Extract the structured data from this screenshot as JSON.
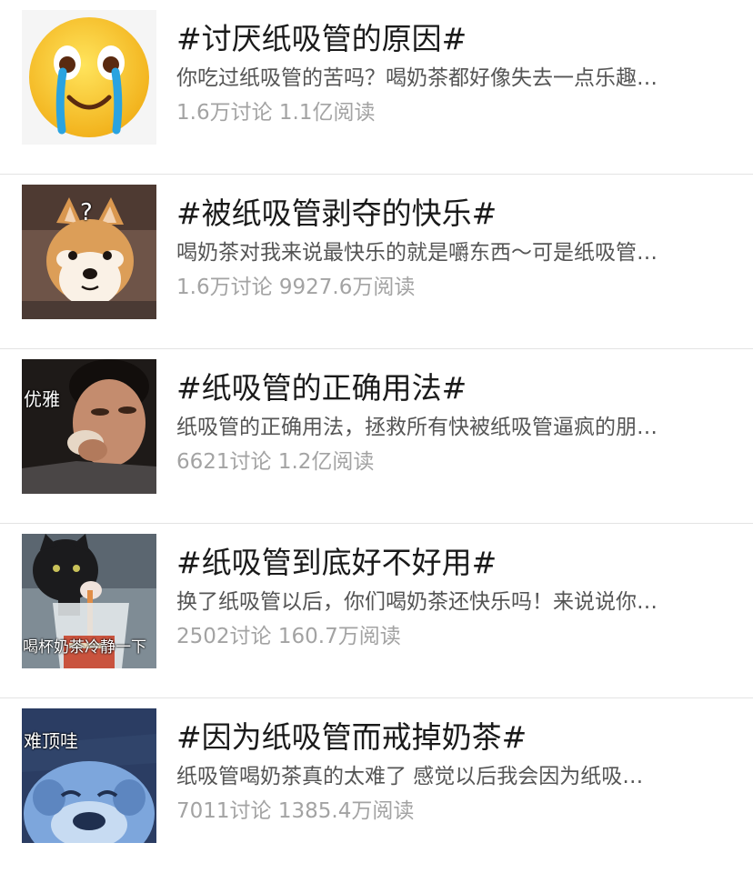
{
  "topics": [
    {
      "title": "#讨厌纸吸管的原因#",
      "description": "你吃过纸吸管的苦吗？喝奶茶都好像失去一点乐趣…",
      "discussions": "1.6万讨论",
      "reads": "1.1亿阅读",
      "thumbnail": "crying-emoji"
    },
    {
      "title": "#被纸吸管剥夺的快乐#",
      "description": "喝奶茶对我来说最快乐的就是嚼东西～可是纸吸管…",
      "discussions": "1.6万讨论",
      "reads": "9927.6万阅读",
      "thumbnail": "shiba-dog-meme",
      "caption": "?"
    },
    {
      "title": "#纸吸管的正确用法#",
      "description": "纸吸管的正确用法，拯救所有快被纸吸管逼疯的朋…",
      "discussions": "6621讨论",
      "reads": "1.2亿阅读",
      "thumbnail": "person-straw-meme",
      "caption": "优雅"
    },
    {
      "title": "#纸吸管到底好不好用#",
      "description": "换了纸吸管以后，你们喝奶茶还快乐吗！来说说你…",
      "discussions": "2502讨论",
      "reads": "160.7万阅读",
      "thumbnail": "cat-drinking-meme",
      "caption": "喝杯奶茶冷静一下"
    },
    {
      "title": "#因为纸吸管而戒掉奶茶#",
      "description": "纸吸管喝奶茶真的太难了 感觉以后我会因为纸吸…",
      "discussions": "7011讨论",
      "reads": "1385.4万阅读",
      "thumbnail": "crying-cartoon-meme",
      "caption": "难顶哇"
    }
  ]
}
